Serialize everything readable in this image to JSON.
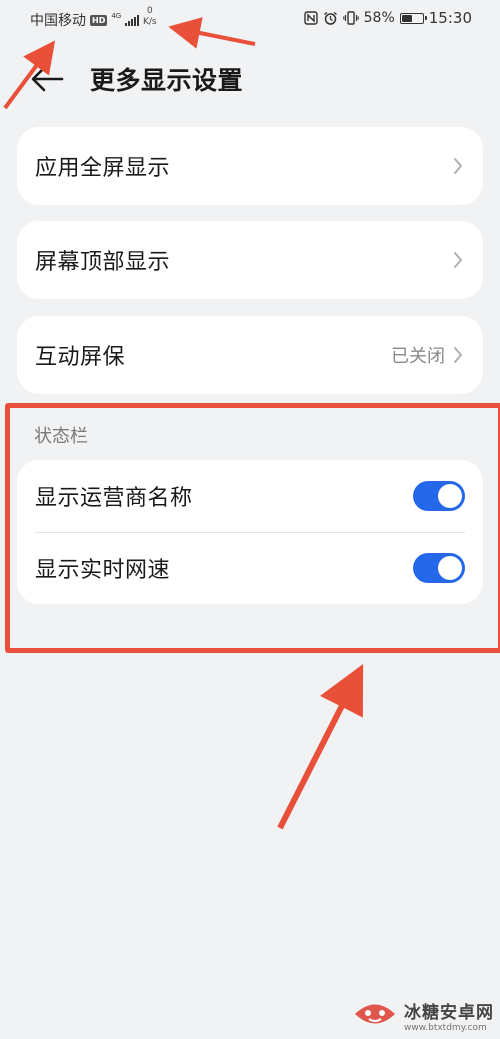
{
  "status_bar": {
    "carrier": "中国移动",
    "hd": "HD",
    "network": "4G",
    "speed_value": "0",
    "speed_unit": "K/s",
    "battery": "58%",
    "battery_level": 0.58,
    "time": "15:30"
  },
  "header": {
    "back_icon": "back-arrow-icon",
    "title": "更多显示设置"
  },
  "items": [
    {
      "label": "应用全屏显示"
    },
    {
      "label": "屏幕顶部显示"
    },
    {
      "label": "互动屏保",
      "value": "已关闭"
    }
  ],
  "status_section": {
    "title": "状态栏",
    "toggles": [
      {
        "label": "显示运营商名称",
        "on": true
      },
      {
        "label": "显示实时网速",
        "on": true
      }
    ]
  },
  "watermark": {
    "name": "冰糖安卓网",
    "url": "www.btxtdmy.com"
  },
  "colors": {
    "accent": "#2467e8",
    "annotation": "#e8503a",
    "background": "#f1f2f4"
  }
}
